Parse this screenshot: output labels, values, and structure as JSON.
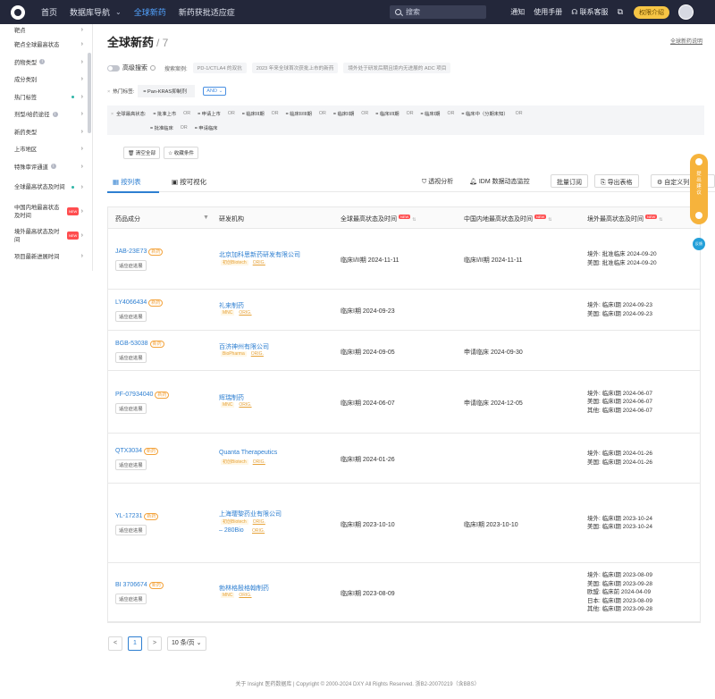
{
  "nav": {
    "items": [
      "首页",
      "数据库导航",
      "全球新药",
      "新药获批适应症"
    ],
    "chevron": "chevron-down-icon",
    "search_placeholder": "搜索",
    "links": [
      "通知",
      "使用手册",
      "联系客服"
    ],
    "permission": "权限介绍"
  },
  "sidebar": {
    "items": [
      {
        "label": "靶点"
      },
      {
        "label": "靶点全球最高状态"
      },
      {
        "label": "药物类型"
      },
      {
        "label": "成分类别"
      },
      {
        "label": "热门标签"
      },
      {
        "label": "剂型/给药途径"
      },
      {
        "label": "新药类型"
      },
      {
        "label": "上市地区"
      },
      {
        "label": "特殊审评通道"
      },
      {
        "label": "全球最高状态及时间"
      },
      {
        "label": "中国内地最高状态及时间"
      },
      {
        "label": "境外最高状态及时间"
      },
      {
        "label": "项目最新进展时间"
      }
    ]
  },
  "page": {
    "title": "全球新药",
    "count": "/ 7",
    "title_link": "全球新药说明"
  },
  "advanced": {
    "label": "高级搜索",
    "examples_label": "搜索案例:",
    "examples": [
      "PD-1/CTLA4 的双抗",
      "2023 年来全球首次获批上市的新药",
      "境外处于研发后期且境内无进展的 ADC 项目"
    ]
  },
  "hot": {
    "label": "热门标签:",
    "value": "= Pan-KRAS抑制剂",
    "and": "AND"
  },
  "status": {
    "label": "全球最高状态:",
    "row1": [
      "= 批准上市",
      "OR",
      "= 申请上市",
      "OR",
      "= 临床III期",
      "OR",
      "= 临床II/III期",
      "OR",
      "= 临床II期",
      "OR",
      "= 临床I/II期",
      "OR",
      "= 临床I期",
      "OR",
      "= 临床中（分期未知）",
      "OR"
    ],
    "row2": [
      "= 批准临床",
      "OR",
      "= 申请临床"
    ]
  },
  "actions": {
    "clear": "清空全部",
    "save": "收藏条件"
  },
  "tabs": {
    "list": "按列表",
    "viz": "按可视化"
  },
  "tools": {
    "analysis": "透视分析",
    "monitor": "IDM 数据动态监控",
    "batch": "批量订阅",
    "export": "导出表格",
    "custom": "自定义列"
  },
  "table": {
    "headers": [
      "药品成分",
      "研发机构",
      "全球最高状态及时间",
      "中国内地最高状态及时间",
      "境外最高状态及时间"
    ],
    "new_tag": "NEW",
    "progress_label": "适应症进展",
    "rows": [
      {
        "name": "JAB-23E73",
        "tag": "新药",
        "org": "北京加科思新药研发有限公司",
        "org_tags": [
          "初创Biotech",
          "ORIG."
        ],
        "global": "临床I/II期 2024-11-11",
        "china": "临床I/II期 2024-11-11",
        "overseas": [
          "境外: 批准临床 2024-09-20",
          "美国: 批准临床 2024-09-20"
        ]
      },
      {
        "name": "LY4066434",
        "tag": "新药",
        "org": "礼来制药",
        "org_tags": [
          "MNC",
          "ORIG."
        ],
        "global": "临床I期 2024-09-23",
        "china": "",
        "overseas": [
          "境外: 临床I期 2024-09-23",
          "美国: 临床I期 2024-09-23"
        ]
      },
      {
        "name": "BGB-53038",
        "tag": "新药",
        "org": "百济神州有限公司",
        "org_tags": [
          "BioPharma",
          "ORIG."
        ],
        "global": "临床I期 2024-09-05",
        "china": "申请临床 2024-09-30",
        "overseas": []
      },
      {
        "name": "PF-07934040",
        "tag": "新药",
        "org": "辉瑞制药",
        "org_tags": [
          "MNC",
          "ORIG."
        ],
        "global": "临床I期 2024-06-07",
        "china": "申请临床 2024-12-05",
        "overseas": [
          "境外: 临床I期 2024-06-07",
          "美国: 临床I期 2024-06-07",
          "其他: 临床I期 2024-06-07"
        ]
      },
      {
        "name": "QTX3034",
        "tag": "新药",
        "org": "Quanta Therapeutics",
        "org_tags": [
          "初创Biotech",
          "ORIG."
        ],
        "global": "临床I期 2024-01-26",
        "china": "",
        "overseas": [
          "境外: 临床I期 2024-01-26",
          "美国: 临床I期 2024-01-26"
        ]
      },
      {
        "name": "YL-17231",
        "tag": "新药",
        "org": "上海璎黎药业有限公司",
        "org_tags": [
          "初创Biotech",
          "ORIG."
        ],
        "org2": "280Bio",
        "org2_tags": [
          "ORIG."
        ],
        "global": "临床I期 2023-10-10",
        "china": "临床I期 2023-10-10",
        "overseas": [
          "境外: 临床I期 2023-10-24",
          "美国: 临床I期 2023-10-24"
        ]
      },
      {
        "name": "BI 3706674",
        "tag": "新药",
        "org": "勃林格殷格翰制药",
        "org_tags": [
          "MNC",
          "ORIG."
        ],
        "global": "临床I期 2023-08-09",
        "china": "",
        "overseas": [
          "境外: 临床I期 2023-08-09",
          "美国: 临床I期 2023-09-28",
          "欧盟: 临床前 2024-04-09",
          "日本: 临床I期 2023-08-09",
          "其他: 临床I期 2023-09-28"
        ]
      }
    ]
  },
  "pager": {
    "prev": "<",
    "page": "1",
    "next": ">",
    "size": "10 条/页"
  },
  "footer": "关于 Insight 医药数据库 | Copyright © 2000-2024 DXY All Rights Reserved. 浙B2-20070219（含BBS）",
  "float": {
    "text": "提出建议"
  },
  "float_blue": "反馈"
}
